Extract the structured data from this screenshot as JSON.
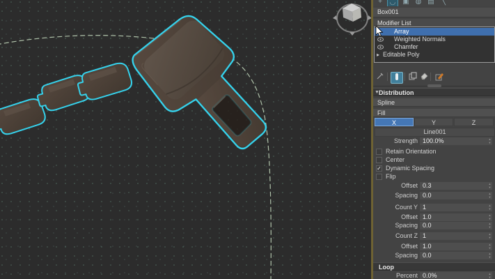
{
  "colors": {
    "selection_outline": "#35d2ec",
    "accent_blue": "#4577b5",
    "model_brown": "#50453c",
    "viewport_bg": "#2c2c2c",
    "spline_green": "#c9dfc2",
    "active_viewport_border": "#6e6233"
  },
  "viewport": {
    "objects": {
      "main_model": "selected buckle mesh",
      "array_clones": "arrayed clip instances",
      "path_spline": "distribution spline curve",
      "viewcube": "view navigation cube"
    }
  },
  "panel": {
    "tabs": [
      "create",
      "modify",
      "hierarchy",
      "motion",
      "display",
      "utilities"
    ],
    "object_name": "Box001",
    "modifier_list_label": "Modifier List",
    "stack": [
      {
        "label": "Array",
        "selected": true
      },
      {
        "label": "Weighted Normals",
        "selected": false
      },
      {
        "label": "Chamfer",
        "selected": false
      },
      {
        "label": "Editable Poly",
        "selected": false,
        "expander": "▸"
      }
    ],
    "stack_tools": [
      "pin-stack",
      "show-end-result",
      "make-unique",
      "remove-modifier",
      "configure-modifier-sets"
    ],
    "distribution": {
      "header": "Distribution",
      "spline_mode": "Spline",
      "fill_mode": "Fill",
      "axes": {
        "x": "X",
        "y": "Y",
        "z": "Z",
        "active": "X"
      },
      "spline_object": "Line001",
      "strength_label": "Strength",
      "strength_value": "100.0%",
      "checkboxes": [
        {
          "label": "Retain Orientation",
          "mark": ""
        },
        {
          "label": "Center",
          "mark": ""
        },
        {
          "label": "Dynamic Spacing",
          "mark": "✓"
        },
        {
          "label": "Flip",
          "mark": ""
        }
      ],
      "rows": [
        {
          "label": "Offset",
          "value": "0.3"
        },
        {
          "label": "Spacing",
          "value": "0.0"
        },
        {
          "label": "Count Y",
          "value": "1"
        },
        {
          "label": "Offset",
          "value": "1.0"
        },
        {
          "label": "Spacing",
          "value": "0.0"
        },
        {
          "label": "Count Z",
          "value": "1"
        },
        {
          "label": "Offset",
          "value": "1.0"
        },
        {
          "label": "Spacing",
          "value": "0.0"
        }
      ]
    },
    "loop": {
      "header": "Loop",
      "percent_label": "Percent",
      "percent_value": "0.0%"
    }
  }
}
